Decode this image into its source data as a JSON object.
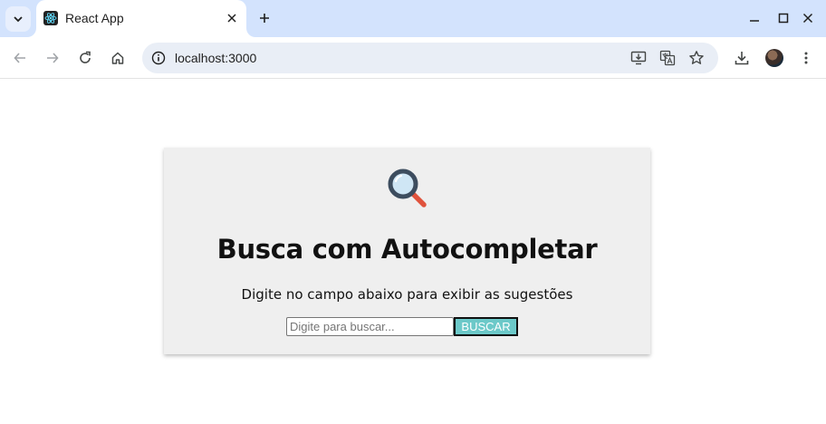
{
  "browser": {
    "tab_title": "React App",
    "url": "localhost:3000"
  },
  "icons": {
    "tab_search": "chevron-down-icon",
    "favicon": "react-logo-icon",
    "tab_close": "close-icon",
    "new_tab": "plus-icon",
    "minimize": "minimize-icon",
    "maximize": "maximize-icon",
    "close_window": "close-icon",
    "back": "arrow-left-icon",
    "forward": "arrow-right-icon",
    "reload": "reload-icon",
    "home": "home-icon",
    "site_info": "tune-icon",
    "install_app": "install-icon",
    "translate": "translate-icon",
    "bookmark": "star-icon",
    "downloads": "download-icon",
    "menu": "kebab-menu-icon",
    "search_hero": "magnifying-glass-icon"
  },
  "colors": {
    "tabstrip": "#d3e3fd",
    "omnibox": "#e9eef6",
    "card_background": "#efefef",
    "button_background": "#6cc9c9",
    "magnifier_handle": "#e0533d",
    "magnifier_frame": "#3d4d5f"
  },
  "page": {
    "title": "Busca com Autocompletar",
    "subtitle": "Digite no campo abaixo para exibir as sugestões",
    "search": {
      "placeholder": "Digite para buscar...",
      "value": "",
      "button_label": "BUSCAR"
    }
  }
}
